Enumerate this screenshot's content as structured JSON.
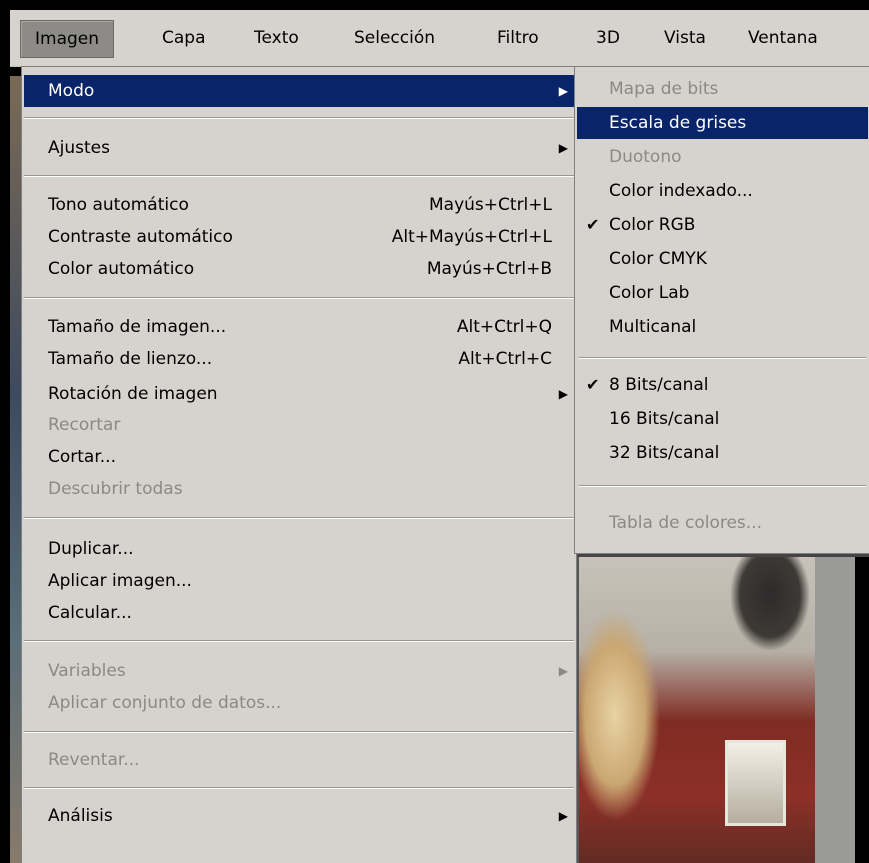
{
  "menubar": {
    "items": [
      {
        "label": "Imagen"
      },
      {
        "label": "Capa"
      },
      {
        "label": "Texto"
      },
      {
        "label": "Selección"
      },
      {
        "label": "Filtro"
      },
      {
        "label": "3D"
      },
      {
        "label": "Vista"
      },
      {
        "label": "Ventana"
      }
    ]
  },
  "menu": {
    "modo": {
      "label": "Modo"
    },
    "ajustes": {
      "label": "Ajustes"
    },
    "tono_auto": {
      "label": "Tono automático",
      "shortcut": "Mayús+Ctrl+L"
    },
    "contraste_auto": {
      "label": "Contraste automático",
      "shortcut": "Alt+Mayús+Ctrl+L"
    },
    "color_auto": {
      "label": "Color automático",
      "shortcut": "Mayús+Ctrl+B"
    },
    "tamano_imagen": {
      "label": "Tamaño de imagen...",
      "shortcut": "Alt+Ctrl+Q"
    },
    "tamano_lienzo": {
      "label": "Tamaño de lienzo...",
      "shortcut": "Alt+Ctrl+C"
    },
    "rotacion": {
      "label": "Rotación de imagen"
    },
    "recortar": {
      "label": "Recortar"
    },
    "cortar": {
      "label": "Cortar..."
    },
    "descubrir": {
      "label": "Descubrir todas"
    },
    "duplicar": {
      "label": "Duplicar..."
    },
    "aplicar_imagen": {
      "label": "Aplicar imagen..."
    },
    "calcular": {
      "label": "Calcular..."
    },
    "variables": {
      "label": "Variables"
    },
    "aplicar_conjunto": {
      "label": "Aplicar conjunto de datos..."
    },
    "reventar": {
      "label": "Reventar..."
    },
    "analisis": {
      "label": "Análisis"
    }
  },
  "submenu": {
    "mapa_bits": {
      "label": "Mapa de bits"
    },
    "escala_grises": {
      "label": "Escala de grises"
    },
    "duotono": {
      "label": "Duotono"
    },
    "color_indexado": {
      "label": "Color indexado..."
    },
    "color_rgb": {
      "label": "Color RGB",
      "checked": true
    },
    "color_cmyk": {
      "label": "Color CMYK"
    },
    "color_lab": {
      "label": "Color Lab"
    },
    "multicanal": {
      "label": "Multicanal"
    },
    "bits8": {
      "label": "8 Bits/canal",
      "checked": true
    },
    "bits16": {
      "label": "16 Bits/canal"
    },
    "bits32": {
      "label": "32 Bits/canal"
    },
    "tabla_colores": {
      "label": "Tabla de colores..."
    }
  },
  "glyphs": {
    "check": "✔",
    "arrow": "▶"
  },
  "colors": {
    "selection": "#0a246a",
    "menu_bg": "#d6d3ce",
    "disabled": "#8c8984"
  }
}
